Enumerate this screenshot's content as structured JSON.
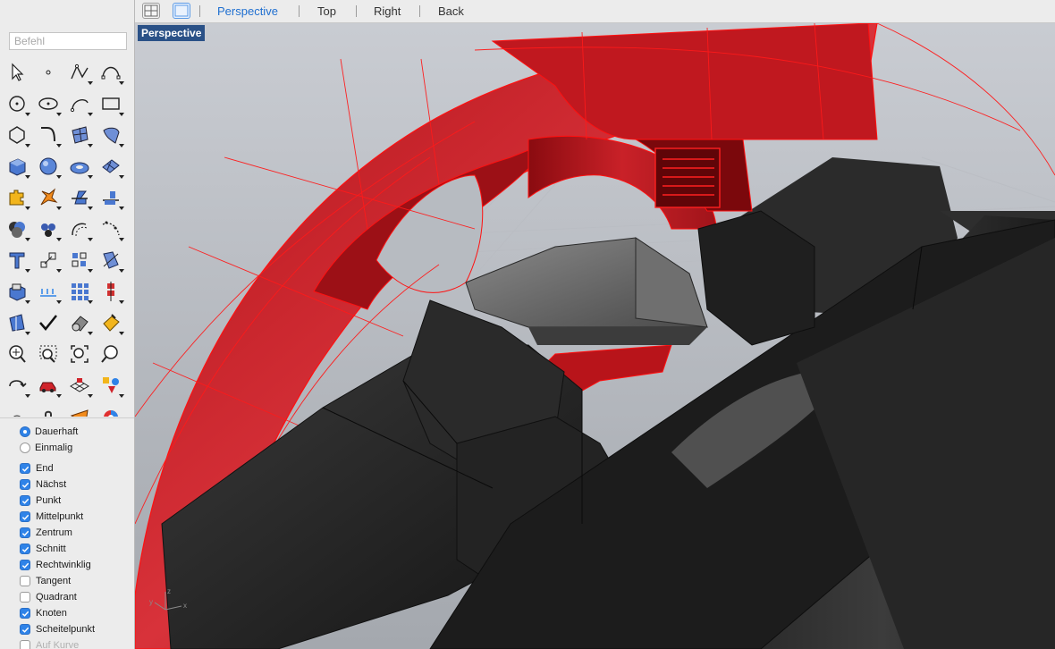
{
  "command": {
    "placeholder": "Befehl",
    "value": ""
  },
  "toolbar": {
    "layout_buttons": [
      "four-viewports",
      "single-viewport"
    ],
    "tabs": [
      {
        "label": "Perspective",
        "active": true
      },
      {
        "label": "Top",
        "active": false
      },
      {
        "label": "Right",
        "active": false
      },
      {
        "label": "Back",
        "active": false
      }
    ]
  },
  "viewport": {
    "label": "Perspective",
    "axes": {
      "z": "z",
      "y": "y",
      "x": "x"
    }
  },
  "tools": [
    "select-arrow-icon",
    "point-icon",
    "polyline-icon",
    "curve-icon",
    "circle-icon",
    "ellipse-icon",
    "arc-icon",
    "rectangle-icon",
    "polygon-icon",
    "fillet-curve-icon",
    "surface-patch-icon",
    "loft-surface-icon",
    "box-solid-icon",
    "sphere-solid-icon",
    "torus-solid-icon",
    "mesh-plane-icon",
    "join-puzzle-icon",
    "explode-icon",
    "trim-icon",
    "split-icon",
    "boolean-union-icon",
    "group-icon",
    "offset-curve-icon",
    "rebuild-curve-icon",
    "text-icon",
    "scale-icon",
    "array-icon",
    "project-curve-icon",
    "extrude-icon",
    "dimension-icon",
    "grid-array-icon",
    "align-icon",
    "analyze-icon",
    "check-icon",
    "shade-icon",
    "render-icon",
    "zoom-in-icon",
    "zoom-window-icon",
    "zoom-extents-icon",
    "zoom-icon",
    "rotate-view-icon",
    "car-icon",
    "transform-grid-icon",
    "paint-icon",
    "light-icon",
    "lock-icon",
    "point-cloud-icon",
    "color-wheel-icon"
  ],
  "osnap": {
    "mode": [
      {
        "label": "Dauerhaft",
        "selected": true
      },
      {
        "label": "Einmalig",
        "selected": false
      }
    ],
    "snaps": [
      {
        "label": "End",
        "checked": true
      },
      {
        "label": "Nächst",
        "checked": true
      },
      {
        "label": "Punkt",
        "checked": true
      },
      {
        "label": "Mittelpunkt",
        "checked": true
      },
      {
        "label": "Zentrum",
        "checked": true
      },
      {
        "label": "Schnitt",
        "checked": true
      },
      {
        "label": "Rechtwinklig",
        "checked": true
      },
      {
        "label": "Tangent",
        "checked": false
      },
      {
        "label": "Quadrant",
        "checked": false
      },
      {
        "label": "Knoten",
        "checked": true
      },
      {
        "label": "Scheitelpunkt",
        "checked": true
      },
      {
        "label": "Auf Kurve",
        "checked": false
      }
    ]
  },
  "colors": {
    "accent": "#1f6fd0",
    "viewport_label_bg": "#2a5187",
    "selection_red": "#e01010",
    "dark_geometry": "#1e1e1e",
    "panel_bg": "#ececec"
  }
}
